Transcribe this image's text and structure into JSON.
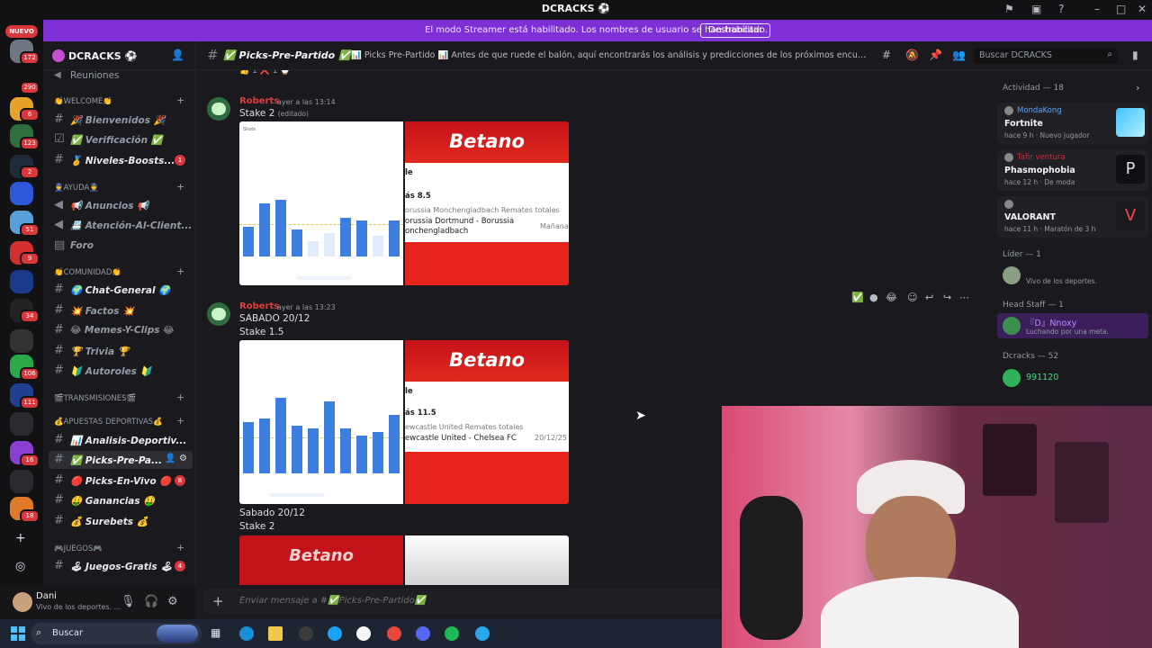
{
  "window": {
    "title": "DCRACKS ⚽",
    "title_icon": "discord-badge-icon"
  },
  "banner": {
    "message": "El modo Streamer está habilitado. Los nombres de usuario se han truncado.",
    "button": "Deshabilitar"
  },
  "rail": {
    "new_label": "NUEVO",
    "badges": [
      "172",
      "290",
      "6",
      "123",
      "2",
      "51",
      "9",
      "34",
      "106",
      "111",
      "16",
      "18"
    ]
  },
  "server": {
    "name": "DCRACKS ⚽",
    "top_item": "Reuniones",
    "categories": [
      {
        "label": "👏WELCOME👏"
      },
      {
        "label": "👮AYUDA👮"
      },
      {
        "label": "👏COMUNIDAD👏"
      },
      {
        "label": "🎬TRANSMISIONES🎬"
      },
      {
        "label": "💰APUESTAS DEPORTIVAS💰"
      },
      {
        "label": "🎮JUEGOS🎮"
      }
    ],
    "channels": [
      {
        "label": "🎉 Bienvenidos 🎉"
      },
      {
        "label": "✅ Verificación ✅"
      },
      {
        "label": "🏅 Niveles-Boosts...",
        "badge": "1"
      },
      {
        "label": "📢 Anuncios 📢"
      },
      {
        "label": "📇 Atención-Al-Client..."
      },
      {
        "label": "Foro"
      },
      {
        "label": "🌍 Chat-General 🌍"
      },
      {
        "label": "💥 Factos 💥"
      },
      {
        "label": "😂 Memes-Y-Clips 😂"
      },
      {
        "label": "🏆 Trivia 🏆"
      },
      {
        "label": "🔰 Autoroles 🔰"
      },
      {
        "label": "📊 Analisis-Deportiv..."
      },
      {
        "label": "✅ Picks-Pre-Pa..."
      },
      {
        "label": "🔴 Picks-En-Vivo 🔴",
        "badge": "8"
      },
      {
        "label": "🤑 Ganancias 🤑"
      },
      {
        "label": "💰 Surebets 💰"
      },
      {
        "label": "🕹 Juegos-Gratis 🕹",
        "badge": "4"
      }
    ]
  },
  "user": {
    "name": "Dani",
    "status": "Vivo de los deportes. ..."
  },
  "channel_header": {
    "name": "✅ Picks-Pre-Partido ✅",
    "topic": "📊 Picks Pre-Partido 📊 Antes de que ruede el balón, aquí encontrarás los análisis y predicciones de los próximos encuentros. Comparte tus pr...",
    "search_placeholder": "Buscar DCRACKS"
  },
  "messages": [
    {
      "author": "Roberts",
      "time": "ayer a las 13:14",
      "text": "Stake 2",
      "edited": "(editado)",
      "bet": {
        "line1": "le",
        "line2": "ás 8.5",
        "line3": "orussia Monchengladbach Remates totales",
        "line4": "orussia Dortmund - Borussia",
        "line5": "onchengladbach",
        "when": "Mañana"
      },
      "chart_values": [
        10,
        18,
        19,
        9,
        5,
        8,
        13,
        12,
        7,
        12
      ]
    },
    {
      "author": "Roberts",
      "time": "ayer a las 13:23",
      "text": "SABADO 20/12",
      "text2": "Stake 1.5",
      "bet": {
        "line1": "le",
        "line2": "ás 11.5",
        "line3": "ewcastle United Remates totales",
        "line4": "ewcastle United - Chelsea FC",
        "when": "20/12/25"
      },
      "chart_values": [
        15,
        16,
        22,
        14,
        13,
        21,
        13,
        11,
        12,
        17
      ]
    },
    {
      "text": "Sabado 20/12",
      "text2": "Stake 2",
      "bet_logo": "Betano"
    }
  ],
  "bet_logo": "Betano",
  "composer": {
    "placeholder": "Enviar mensaje a #✅Picks-Pre-Partido✅"
  },
  "members": {
    "activity_header": "Actividad — 18",
    "activities": [
      {
        "user": "MondaKong",
        "game": "Fortnite",
        "detail": "hace 9 h · Nuevo jugador",
        "color": "#5aa7ff"
      },
      {
        "user": "Tafir ventura",
        "game": "Phasmophobia",
        "detail": "hace 12 h · De moda",
        "color": "#d4293a"
      },
      {
        "user": "",
        "game": "VALORANT",
        "detail": "hace 11 h · Maratón de 3 h",
        "color": "#d4293a"
      }
    ],
    "groups": [
      {
        "header": "Líder — 1",
        "members": [
          {
            "name": "",
            "status": "Vivo de los deportes."
          }
        ]
      },
      {
        "header": "Head Staff — 1",
        "members": [
          {
            "name": "『D』Nnoxy",
            "status": "Luchando por una meta."
          }
        ]
      },
      {
        "header": "Dcracks — 52",
        "members": [
          {
            "name": "991120",
            "status": ""
          }
        ]
      }
    ]
  },
  "taskbar": {
    "search_placeholder": "Buscar"
  }
}
